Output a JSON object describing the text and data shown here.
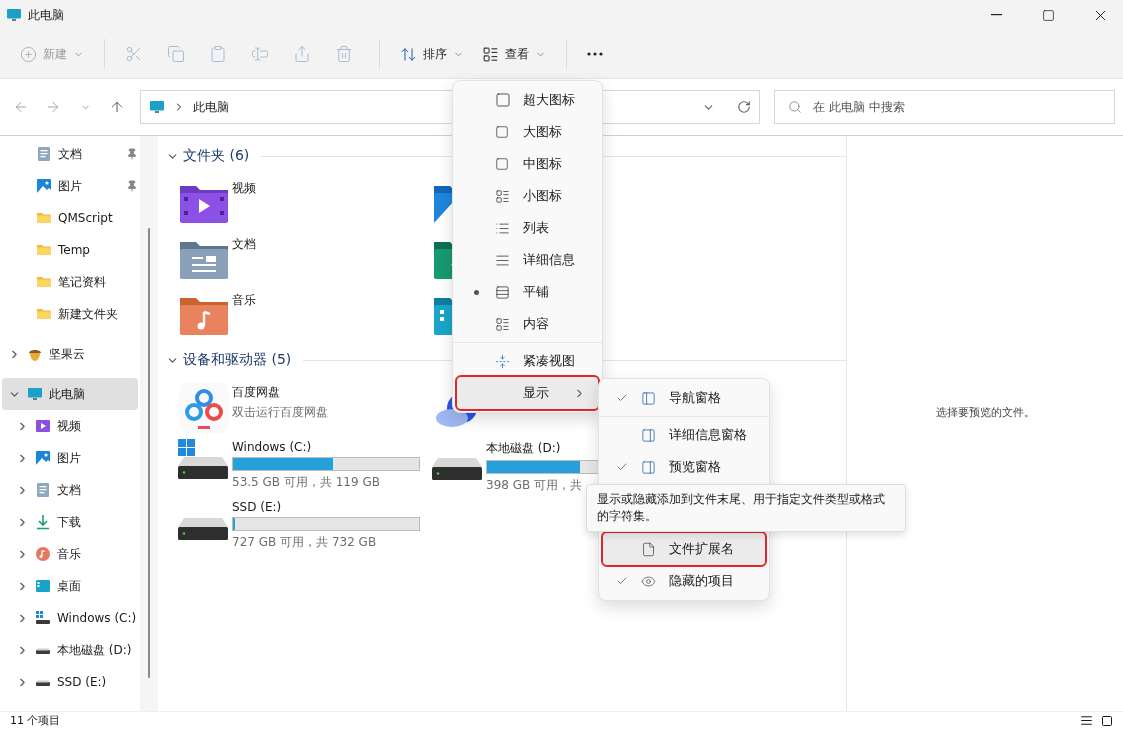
{
  "window": {
    "title": "此电脑"
  },
  "toolbar": {
    "new_button": {
      "label": "新建",
      "disabled": true
    },
    "actions": [
      {
        "kind": "cut",
        "disabled": true
      },
      {
        "kind": "copy",
        "disabled": true
      },
      {
        "kind": "paste",
        "disabled": true
      },
      {
        "kind": "rename",
        "disabled": true
      },
      {
        "kind": "share",
        "disabled": true
      },
      {
        "kind": "delete",
        "disabled": true
      }
    ],
    "sort_button": {
      "label": "排序"
    },
    "view_button": {
      "label": "查看"
    }
  },
  "address": {
    "path": "此电脑"
  },
  "search": {
    "placeholder": "在 此电脑 中搜索"
  },
  "sidebar": {
    "quick_access": [
      {
        "label": "文档",
        "kind": "documents",
        "pinned": true
      },
      {
        "label": "图片",
        "kind": "pictures",
        "pinned": true
      },
      {
        "label": "QMScript",
        "kind": "folder",
        "pinned": false
      },
      {
        "label": "Temp",
        "kind": "folder",
        "pinned": false
      },
      {
        "label": "笔记资料",
        "kind": "folder",
        "pinned": false
      },
      {
        "label": "新建文件夹",
        "kind": "folder",
        "pinned": false
      }
    ],
    "tree": [
      {
        "label": "坚果云",
        "kind": "cloud",
        "expanded": false,
        "selected": false
      },
      {
        "label": "此电脑",
        "kind": "pc",
        "expanded": true,
        "selected": true,
        "children": [
          {
            "label": "视频",
            "kind": "videos",
            "expanded": false,
            "selected": false
          },
          {
            "label": "图片",
            "kind": "pictures",
            "expanded": false,
            "selected": false
          },
          {
            "label": "文档",
            "kind": "documents",
            "expanded": false,
            "selected": false
          },
          {
            "label": "下载",
            "kind": "downloads",
            "expanded": false,
            "selected": false
          },
          {
            "label": "音乐",
            "kind": "music",
            "expanded": false,
            "selected": false
          },
          {
            "label": "桌面",
            "kind": "desktop",
            "expanded": false,
            "selected": false
          },
          {
            "label": "Windows (C:)",
            "kind": "system_drive",
            "expanded": false,
            "selected": false
          },
          {
            "label": "本地磁盘 (D:)",
            "kind": "drive",
            "expanded": false,
            "selected": false
          },
          {
            "label": "SSD (E:)",
            "kind": "drive",
            "expanded": false,
            "selected": false
          }
        ]
      }
    ]
  },
  "sections": [
    {
      "title": "文件夹 (6)",
      "expanded": true,
      "items": [
        {
          "kind": "videos",
          "label": "视频"
        },
        {
          "kind": "pictures"
        },
        {
          "kind": "documents",
          "label": "文档"
        },
        {
          "kind": "downloads"
        },
        {
          "kind": "music",
          "label": "音乐"
        },
        {
          "kind": "desktop"
        }
      ]
    },
    {
      "title": "设备和驱动器 (5)",
      "expanded": true,
      "items": [
        {
          "kind": "app",
          "label": "百度网盘",
          "subtitle": "双击运行百度网盘"
        },
        {
          "kind": "cloud_app"
        },
        {
          "kind": "drive",
          "system": true,
          "label": "Windows (C:)",
          "level": 0.54,
          "caption": "53.5 GB 可用，共 119 GB"
        },
        {
          "kind": "drive",
          "system": false,
          "label": "本地磁盘 (D:)",
          "level": 0.5,
          "caption": "398 GB 可用，共"
        },
        {
          "kind": "drive",
          "system": false,
          "label": "SSD (E:)",
          "level": 0.01,
          "caption": "727 GB 可用，共 732 GB"
        }
      ]
    }
  ],
  "preview": {
    "message": "选择要预览的文件。"
  },
  "status_bar": {
    "count": "11 个项目"
  },
  "view_menu": {
    "layouts": [
      {
        "label": "超大图标",
        "selected": false
      },
      {
        "label": "大图标",
        "selected": false
      },
      {
        "label": "中图标",
        "selected": false
      },
      {
        "label": "小图标",
        "selected": false
      },
      {
        "label": "列表",
        "selected": false
      },
      {
        "label": "详细信息",
        "selected": false
      },
      {
        "label": "平铺",
        "selected": true
      },
      {
        "label": "内容",
        "selected": false
      }
    ],
    "compact": {
      "label": "紧凑视图"
    },
    "show": {
      "label": "显示",
      "hovered": true,
      "annotated": true
    }
  },
  "show_menu": {
    "items": [
      {
        "label": "导航窗格",
        "checked": true,
        "hovered": false,
        "annotated": false
      },
      {
        "label": "详细信息窗格",
        "checked": false,
        "hovered": false,
        "annotated": false
      },
      {
        "label": "预览窗格",
        "checked": true,
        "hovered": false,
        "annotated": false
      },
      {
        "label": "文件扩展名",
        "checked": false,
        "hovered": true,
        "annotated": true,
        "tooltip": "显示或隐藏添加到文件末尾、用于指定文件类型或格式的字符集。"
      },
      {
        "label": "隐藏的项目",
        "checked": true,
        "hovered": false,
        "annotated": false
      }
    ]
  }
}
